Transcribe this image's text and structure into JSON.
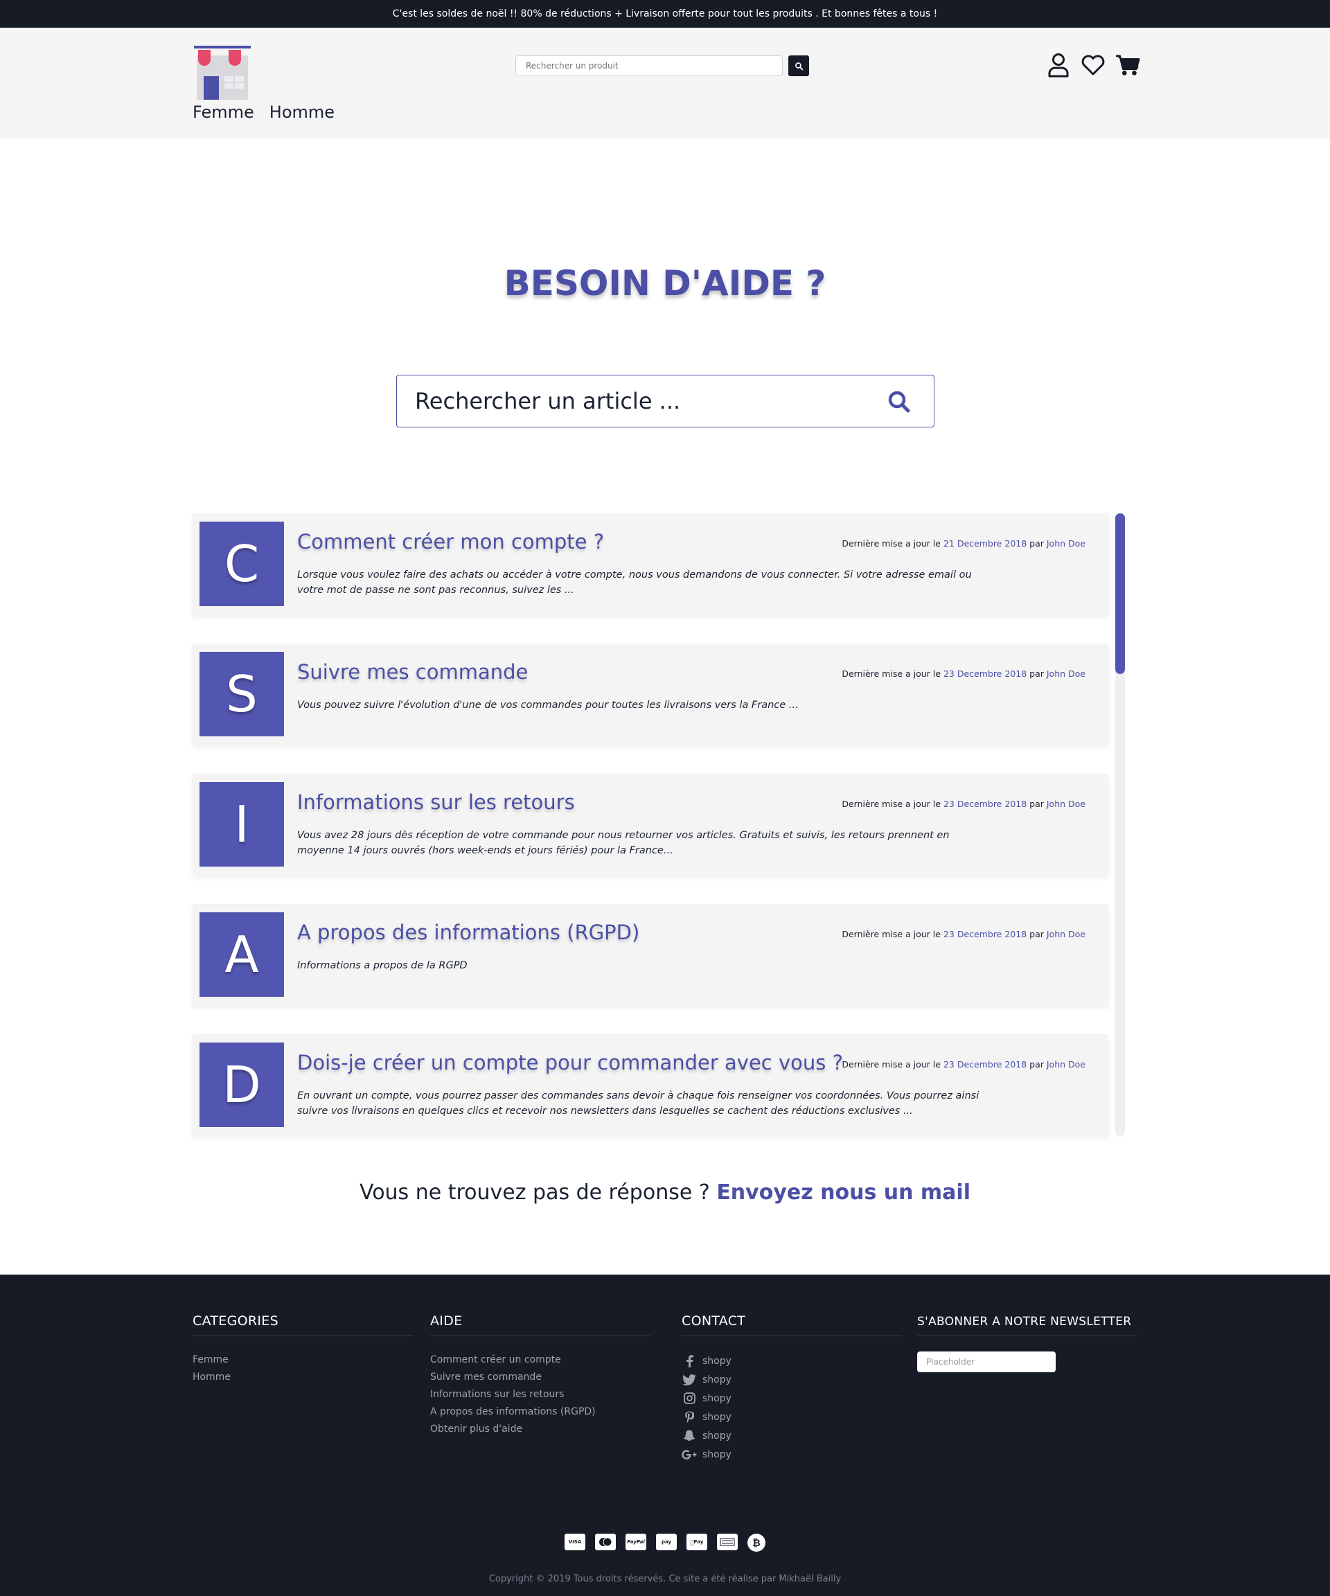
{
  "promo_bar": {
    "text": "C'est les soldes de noël !! 80% de réductions + Livraison offerte pour tout les produits . Et bonnes fêtes a tous !"
  },
  "header": {
    "nav": [
      "Femme",
      "Homme"
    ],
    "search_placeholder": "Rechercher un produit",
    "icons": [
      "user-icon",
      "heart-icon",
      "cart-icon"
    ]
  },
  "help": {
    "title": "BESOIN D'AIDE ?",
    "search_placeholder": "Rechercher un article ..."
  },
  "faq": {
    "meta_prefix": "Dernière mise a jour le",
    "meta_by": "par",
    "items": [
      {
        "letter": "C",
        "title": "Comment créer mon compte ?",
        "date": "21 Decembre 2018",
        "author": "John Doe",
        "description": "Lorsque vous voulez faire des achats ou accéder à votre compte, nous vous demandons de vous connecter. Si votre adresse email ou votre mot de passe ne sont pas reconnus, suivez les ..."
      },
      {
        "letter": "S",
        "title": "Suivre mes commande",
        "date": "23 Decembre 2018",
        "author": "John Doe",
        "description": "Vous pouvez suivre l'évolution d'une de vos commandes pour toutes les livraisons vers la France ..."
      },
      {
        "letter": "I",
        "title": "Informations sur les retours",
        "date": "23 Decembre 2018",
        "author": "John Doe",
        "description": "Vous avez 28 jours dès réception de votre commande pour nous retourner vos articles. Gratuits et suivis, les retours prennent en moyenne 14 jours ouvrés (hors week-ends et jours fériés) pour la France..."
      },
      {
        "letter": "A",
        "title": "A propos des informations (RGPD)",
        "date": "23 Decembre 2018",
        "author": "John Doe",
        "description": "Informations a propos de la RGPD"
      },
      {
        "letter": "D",
        "title": "Dois-je créer un compte pour commander avec vous ?",
        "date": "23 Decembre 2018",
        "author": "John Doe",
        "description": "En ouvrant un compte, vous pourrez passer des commandes sans devoir à chaque fois renseigner vos coordonnées. Vous pourrez ainsi suivre vos livraisons en quelques clics et recevoir nos newsletters dans lesquelles se cachent des réductions exclusives ..."
      }
    ]
  },
  "contact_prompt": {
    "text": "Vous ne trouvez pas de réponse ?",
    "link": "Envoyez nous un mail"
  },
  "footer": {
    "categories": {
      "title": "CATEGORIES",
      "links": [
        "Femme",
        "Homme"
      ]
    },
    "aide": {
      "title": "AIDE",
      "links": [
        "Comment créer un compte",
        "Suivre mes commande",
        "Informations sur les retours",
        "A propos des informations (RGPD)",
        "Obtenir plus d'aide"
      ]
    },
    "contact": {
      "title": "CONTACT",
      "items": [
        {
          "icon": "facebook-icon",
          "label": "shopy"
        },
        {
          "icon": "twitter-icon",
          "label": "shopy"
        },
        {
          "icon": "instagram-icon",
          "label": "shopy"
        },
        {
          "icon": "pinterest-icon",
          "label": "shopy"
        },
        {
          "icon": "snapchat-icon",
          "label": "shopy"
        },
        {
          "icon": "google-plus-icon",
          "label": "shopy"
        }
      ]
    },
    "newsletter": {
      "title": "S'ABONNER A NOTRE NEWSLETTER",
      "placeholder": "Placeholder"
    },
    "payments": [
      {
        "icon": "visa-icon",
        "label": "VISA"
      },
      {
        "icon": "mastercard-icon",
        "label": ""
      },
      {
        "icon": "paypal-icon",
        "label": "PayPal"
      },
      {
        "icon": "amazon-pay-icon",
        "label": "pay"
      },
      {
        "icon": "apple-pay-icon",
        "label": "Pay"
      },
      {
        "icon": "amex-icon",
        "label": ""
      },
      {
        "icon": "bitcoin-icon",
        "label": "₿"
      }
    ],
    "copyright": "Copyright © 2019 Tous droits réservés. Ce site a été réalise par Mikhaël Bailly"
  },
  "colors": {
    "accent": "#4b4fa6",
    "letter_bg": "#5356b0",
    "dark": "#161b25",
    "header_bg": "#f5f5f5",
    "card_bg": "#f4f4f4",
    "logo_pink": "#e6496a"
  }
}
